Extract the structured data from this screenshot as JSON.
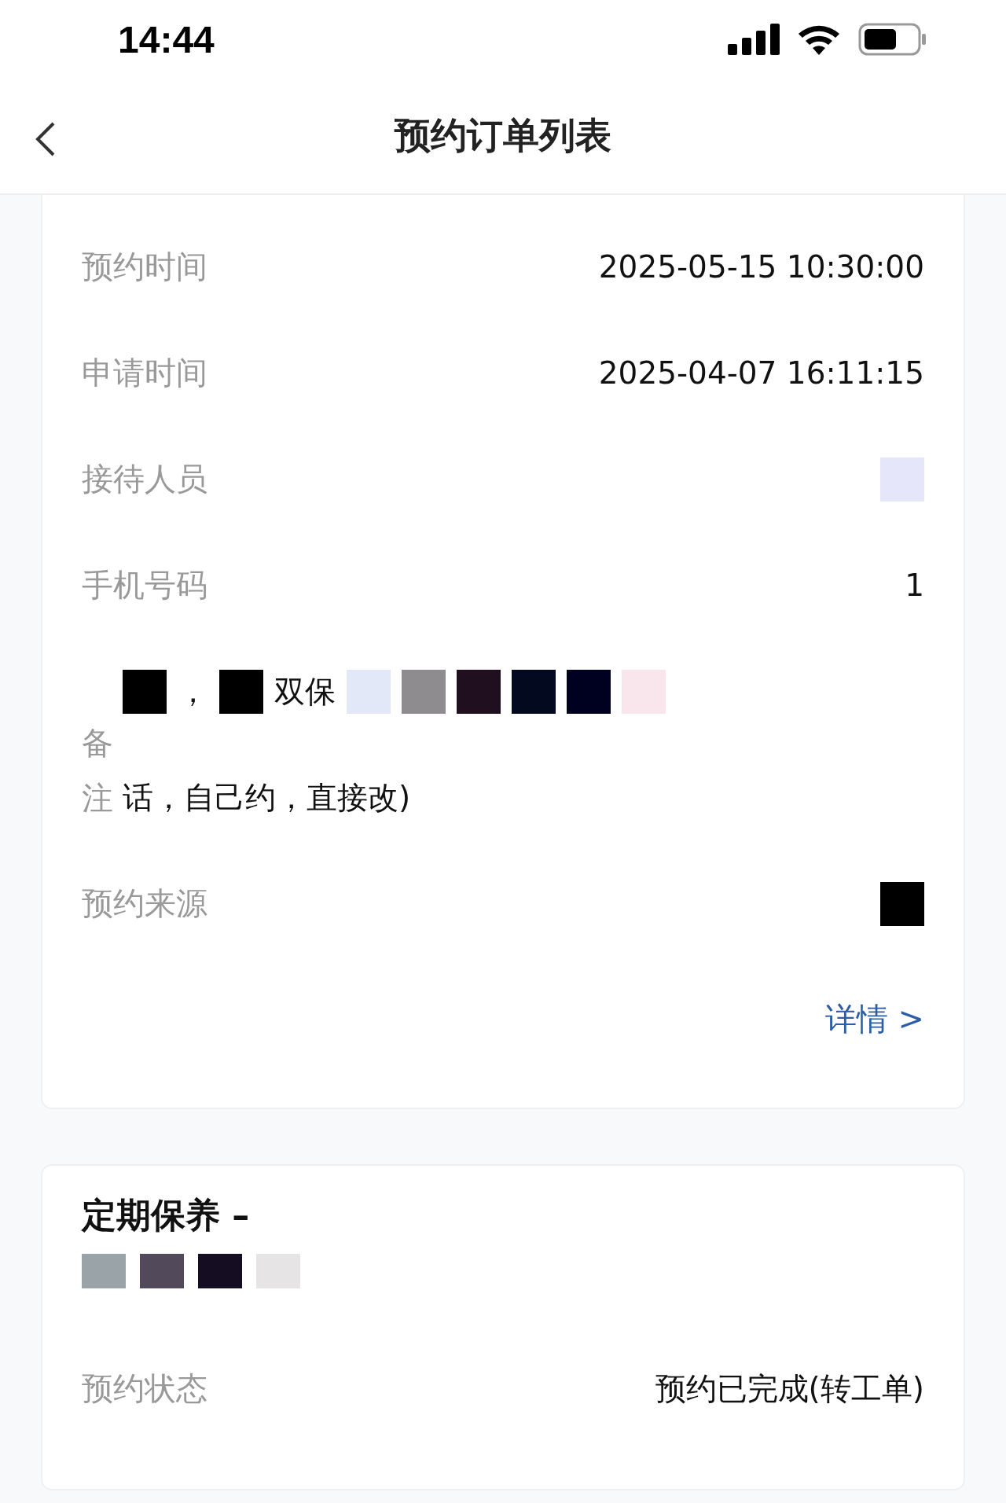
{
  "status_bar": {
    "time": "14:44"
  },
  "nav": {
    "title": "预约订单列表"
  },
  "cards": [
    {
      "rows": [
        {
          "kind": "field",
          "label": "预约时间",
          "segments": [
            {
              "kind": "text",
              "text": "2025-05-15 10:30:00"
            }
          ]
        },
        {
          "kind": "field",
          "label": "申请时间",
          "segments": [
            {
              "kind": "text",
              "text": "2025-04-07 16:11:15"
            }
          ]
        },
        {
          "kind": "field",
          "label": "接待人员",
          "segments": [
            {
              "kind": "redaction",
              "color": "#e6e6fa"
            }
          ]
        },
        {
          "kind": "field",
          "label": "手机号码",
          "segments": [
            {
              "kind": "text",
              "text": "1"
            }
          ]
        },
        {
          "kind": "remark",
          "label": "备注",
          "lines": [
            [
              {
                "kind": "redaction",
                "color": "#000000"
              },
              {
                "kind": "text",
                "text": "，"
              },
              {
                "kind": "redaction",
                "color": "#000000"
              },
              {
                "kind": "text",
                "text": "双保"
              },
              {
                "kind": "redaction",
                "color": "#e3e8f8"
              },
              {
                "kind": "redaction",
                "color": "#8e8c8e"
              },
              {
                "kind": "redaction",
                "color": "#200f1f"
              },
              {
                "kind": "redaction",
                "color": "#030a20"
              },
              {
                "kind": "redaction",
                "color": "#000020"
              },
              {
                "kind": "redaction",
                "color": "#f9e6ec"
              }
            ],
            [
              {
                "kind": "text",
                "text": "话，自己约，直接改)"
              }
            ]
          ]
        },
        {
          "kind": "field",
          "label": "预约来源",
          "segments": [
            {
              "kind": "redaction",
              "color": "#000000"
            }
          ]
        }
      ],
      "link": "详情 >"
    },
    {
      "title": "定期保养 –",
      "subtitle": [
        {
          "kind": "redaction",
          "color": "#9aa3a8"
        },
        {
          "kind": "redaction",
          "color": "#524a5a"
        },
        {
          "kind": "redaction",
          "color": "#150d22"
        },
        {
          "kind": "redaction",
          "color": "#e6e4e4"
        }
      ],
      "rows": [
        {
          "kind": "field",
          "label": "预约状态",
          "segments": [
            {
              "kind": "text",
              "text": "预约已完成(转工单)"
            }
          ]
        }
      ]
    }
  ]
}
